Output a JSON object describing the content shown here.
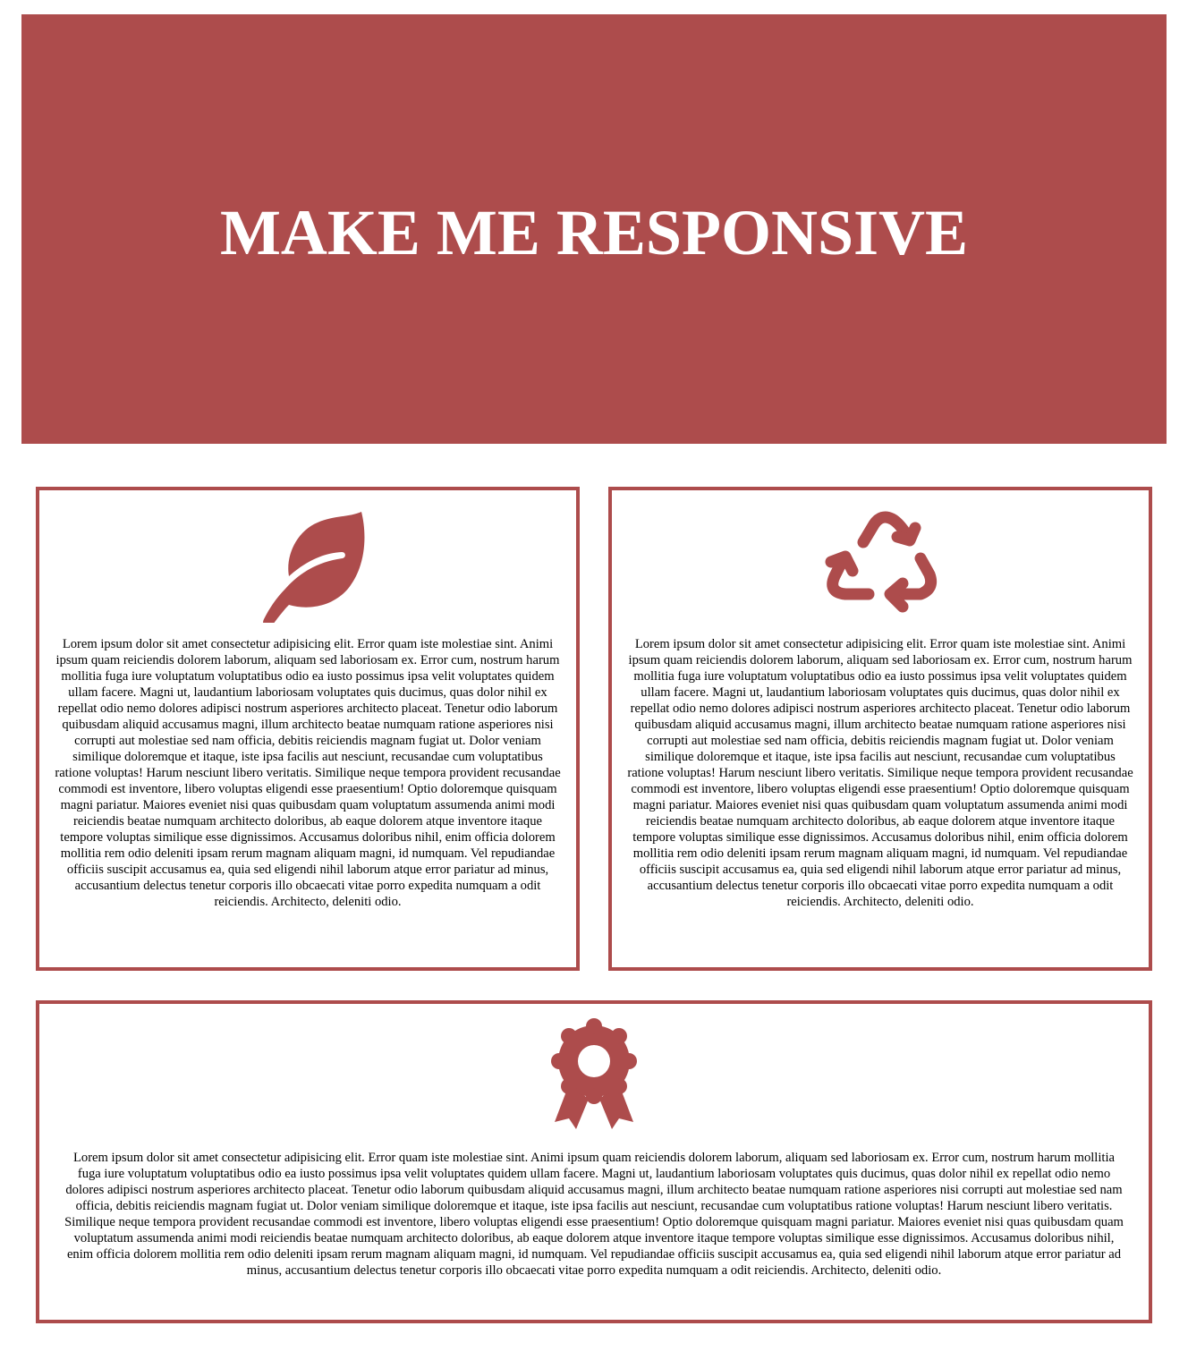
{
  "hero": {
    "title": "MAKE ME RESPONSIVE"
  },
  "colors": {
    "accent": "#ad4c4c",
    "background": "#ffffff",
    "text": "#000000"
  },
  "cards": [
    {
      "icon": "leaf-icon",
      "text": "Lorem ipsum dolor sit amet consectetur adipisicing elit. Error quam iste molestiae sint. Animi ipsum quam reiciendis dolorem laborum, aliquam sed laboriosam ex. Error cum, nostrum harum mollitia fuga iure voluptatum voluptatibus odio ea iusto possimus ipsa velit voluptates quidem ullam facere. Magni ut, laudantium laboriosam voluptates quis ducimus, quas dolor nihil ex repellat odio nemo dolores adipisci nostrum asperiores architecto placeat. Tenetur odio laborum quibusdam aliquid accusamus magni, illum architecto beatae numquam ratione asperiores nisi corrupti aut molestiae sed nam officia, debitis reiciendis magnam fugiat ut. Dolor veniam similique doloremque et itaque, iste ipsa facilis aut nesciunt, recusandae cum voluptatibus ratione voluptas! Harum nesciunt libero veritatis. Similique neque tempora provident recusandae commodi est inventore, libero voluptas eligendi esse praesentium! Optio doloremque quisquam magni pariatur. Maiores eveniet nisi quas quibusdam quam voluptatum assumenda animi modi reiciendis beatae numquam architecto doloribus, ab eaque dolorem atque inventore itaque tempore voluptas similique esse dignissimos. Accusamus doloribus nihil, enim officia dolorem mollitia rem odio deleniti ipsam rerum magnam aliquam magni, id numquam. Vel repudiandae officiis suscipit accusamus ea, quia sed eligendi nihil laborum atque error pariatur ad minus, accusantium delectus tenetur corporis illo obcaecati vitae porro expedita numquam a odit reiciendis. Architecto, deleniti odio."
    },
    {
      "icon": "recycle-icon",
      "text": "Lorem ipsum dolor sit amet consectetur adipisicing elit. Error quam iste molestiae sint. Animi ipsum quam reiciendis dolorem laborum, aliquam sed laboriosam ex. Error cum, nostrum harum mollitia fuga iure voluptatum voluptatibus odio ea iusto possimus ipsa velit voluptates quidem ullam facere. Magni ut, laudantium laboriosam voluptates quis ducimus, quas dolor nihil ex repellat odio nemo dolores adipisci nostrum asperiores architecto placeat. Tenetur odio laborum quibusdam aliquid accusamus magni, illum architecto beatae numquam ratione asperiores nisi corrupti aut molestiae sed nam officia, debitis reiciendis magnam fugiat ut. Dolor veniam similique doloremque et itaque, iste ipsa facilis aut nesciunt, recusandae cum voluptatibus ratione voluptas! Harum nesciunt libero veritatis. Similique neque tempora provident recusandae commodi est inventore, libero voluptas eligendi esse praesentium! Optio doloremque quisquam magni pariatur. Maiores eveniet nisi quas quibusdam quam voluptatum assumenda animi modi reiciendis beatae numquam architecto doloribus, ab eaque dolorem atque inventore itaque tempore voluptas similique esse dignissimos. Accusamus doloribus nihil, enim officia dolorem mollitia rem odio deleniti ipsam rerum magnam aliquam magni, id numquam. Vel repudiandae officiis suscipit accusamus ea, quia sed eligendi nihil laborum atque error pariatur ad minus, accusantium delectus tenetur corporis illo obcaecati vitae porro expedita numquam a odit reiciendis. Architecto, deleniti odio."
    },
    {
      "icon": "award-icon",
      "text": "Lorem ipsum dolor sit amet consectetur adipisicing elit. Error quam iste molestiae sint. Animi ipsum quam reiciendis dolorem laborum, aliquam sed laboriosam ex. Error cum, nostrum harum mollitia fuga iure voluptatum voluptatibus odio ea iusto possimus ipsa velit voluptates quidem ullam facere. Magni ut, laudantium laboriosam voluptates quis ducimus, quas dolor nihil ex repellat odio nemo dolores adipisci nostrum asperiores architecto placeat. Tenetur odio laborum quibusdam aliquid accusamus magni, illum architecto beatae numquam ratione asperiores nisi corrupti aut molestiae sed nam officia, debitis reiciendis magnam fugiat ut. Dolor veniam similique doloremque et itaque, iste ipsa facilis aut nesciunt, recusandae cum voluptatibus ratione voluptas! Harum nesciunt libero veritatis. Similique neque tempora provident recusandae commodi est inventore, libero voluptas eligendi esse praesentium! Optio doloremque quisquam magni pariatur. Maiores eveniet nisi quas quibusdam quam voluptatum assumenda animi modi reiciendis beatae numquam architecto doloribus, ab eaque dolorem atque inventore itaque tempore voluptas similique esse dignissimos. Accusamus doloribus nihil, enim officia dolorem mollitia rem odio deleniti ipsam rerum magnam aliquam magni, id numquam. Vel repudiandae officiis suscipit accusamus ea, quia sed eligendi nihil laborum atque error pariatur ad minus, accusantium delectus tenetur corporis illo obcaecati vitae porro expedita numquam a odit reiciendis. Architecto, deleniti odio."
    }
  ]
}
